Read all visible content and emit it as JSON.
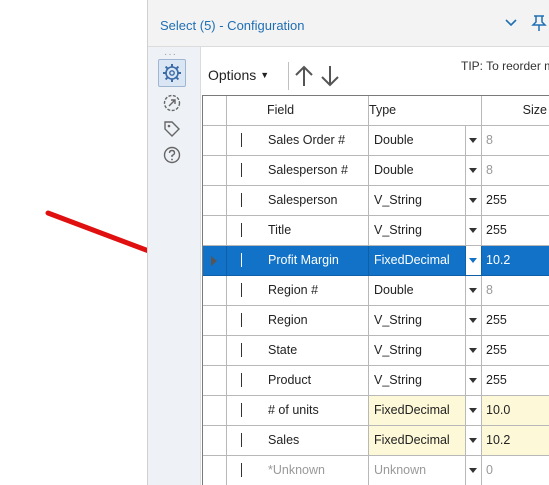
{
  "panel": {
    "title": "Select (5) - Configuration"
  },
  "toolbar": {
    "options_label": "Options",
    "tip": "TIP: To reorder multipl"
  },
  "grid": {
    "columns": {
      "field": "Field",
      "type": "Type",
      "size": "Size"
    },
    "rows": [
      {
        "field": "Sales Order #",
        "type": "Double",
        "size": "8",
        "checked": true,
        "size_dim": true
      },
      {
        "field": "Salesperson #",
        "type": "Double",
        "size": "8",
        "checked": true,
        "size_dim": true
      },
      {
        "field": "Salesperson",
        "type": "V_String",
        "size": "255",
        "checked": true
      },
      {
        "field": "Title",
        "type": "V_String",
        "size": "255",
        "checked": true
      },
      {
        "field": "Profit Margin",
        "type": "FixedDecimal",
        "size": "10.2",
        "checked": true,
        "selected": true
      },
      {
        "field": "Region #",
        "type": "Double",
        "size": "8",
        "checked": true,
        "size_dim": true
      },
      {
        "field": "Region",
        "type": "V_String",
        "size": "255",
        "checked": true
      },
      {
        "field": "State",
        "type": "V_String",
        "size": "255",
        "checked": true
      },
      {
        "field": "Product",
        "type": "V_String",
        "size": "255",
        "checked": true
      },
      {
        "field": "# of units",
        "type": "FixedDecimal",
        "size": "10.0",
        "checked": true,
        "tinted": true
      },
      {
        "field": "Sales",
        "type": "FixedDecimal",
        "size": "10.2",
        "checked": true,
        "tinted": true
      },
      {
        "field": "*Unknown",
        "type": "Unknown",
        "size": "0",
        "checked": false,
        "dim": true
      }
    ]
  },
  "colors": {
    "accent": "#1272c7",
    "annotation_arrow": "#e01010",
    "tinted_cell": "#fdf8d8"
  }
}
